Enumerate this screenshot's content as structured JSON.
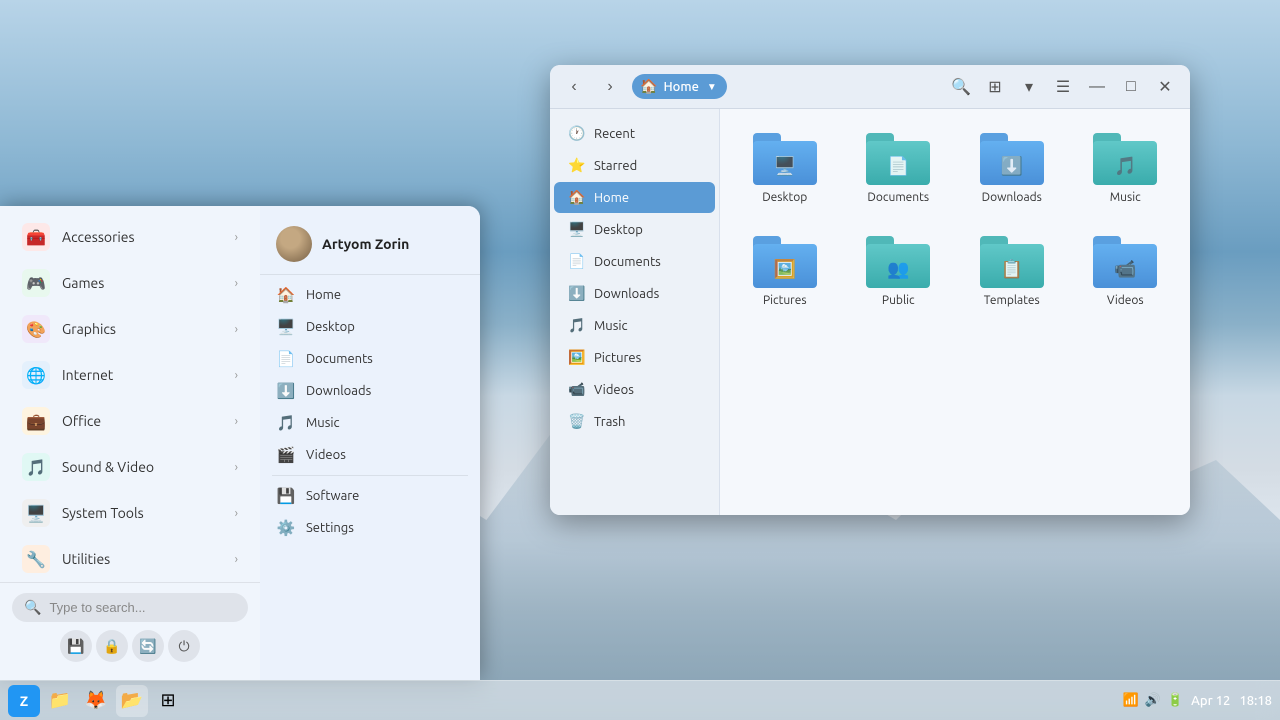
{
  "desktop": {
    "bg": "mountain"
  },
  "taskbar": {
    "time": "18:18",
    "date": "Apr 12",
    "icons": [
      {
        "name": "zorin-menu",
        "label": "Z",
        "active": false
      },
      {
        "name": "files",
        "label": "📁",
        "active": false
      },
      {
        "name": "firefox",
        "label": "🦊",
        "active": false
      },
      {
        "name": "file-manager",
        "label": "📂",
        "active": true
      },
      {
        "name": "zorin-connect",
        "label": "⊞",
        "active": false
      }
    ]
  },
  "app_menu": {
    "user": {
      "name": "Artyom Zorin",
      "avatar": "user"
    },
    "quick_items": [
      {
        "icon": "🏠",
        "label": "Home"
      },
      {
        "icon": "🖥️",
        "label": "Desktop"
      },
      {
        "icon": "📄",
        "label": "Documents"
      },
      {
        "icon": "⬇️",
        "label": "Downloads"
      },
      {
        "icon": "🎵",
        "label": "Music"
      },
      {
        "icon": "🎬",
        "label": "Videos"
      }
    ],
    "bottom_items": [
      {
        "icon": "💾",
        "label": "Software"
      },
      {
        "icon": "⚙️",
        "label": "Settings"
      }
    ],
    "categories": [
      {
        "icon": "🧰",
        "label": "Accessories",
        "color": "#e74c3c"
      },
      {
        "icon": "🎮",
        "label": "Games",
        "color": "#2ecc71"
      },
      {
        "icon": "🎨",
        "label": "Graphics",
        "color": "#9b59b6"
      },
      {
        "icon": "🌐",
        "label": "Internet",
        "color": "#3498db"
      },
      {
        "icon": "💼",
        "label": "Office",
        "color": "#f39c12"
      },
      {
        "icon": "🎵",
        "label": "Sound & Video",
        "color": "#1abc9c"
      },
      {
        "icon": "🖥️",
        "label": "System Tools",
        "color": "#7f8c8d"
      },
      {
        "icon": "🔧",
        "label": "Utilities",
        "color": "#e67e22"
      }
    ],
    "search_placeholder": "Type to search...",
    "action_buttons": [
      {
        "icon": "💾",
        "label": "save"
      },
      {
        "icon": "🔒",
        "label": "lock"
      },
      {
        "icon": "🔄",
        "label": "refresh"
      },
      {
        "icon": "⏻",
        "label": "power"
      }
    ]
  },
  "file_manager": {
    "title": "Home",
    "location": "Home",
    "sidebar_items": [
      {
        "icon": "🕐",
        "label": "Recent",
        "active": false
      },
      {
        "icon": "⭐",
        "label": "Starred",
        "active": false
      },
      {
        "icon": "🏠",
        "label": "Home",
        "active": true
      },
      {
        "icon": "🖥️",
        "label": "Desktop",
        "active": false
      },
      {
        "icon": "📄",
        "label": "Documents",
        "active": false
      },
      {
        "icon": "⬇️",
        "label": "Downloads",
        "active": false
      },
      {
        "icon": "🎵",
        "label": "Music",
        "active": false
      },
      {
        "icon": "🖼️",
        "label": "Pictures",
        "active": false
      },
      {
        "icon": "📹",
        "label": "Videos",
        "active": false
      },
      {
        "icon": "🗑️",
        "label": "Trash",
        "active": false
      }
    ],
    "folders": [
      {
        "label": "Desktop",
        "color": "blue",
        "icon": "🖥️"
      },
      {
        "label": "Documents",
        "color": "teal",
        "icon": "📄"
      },
      {
        "label": "Downloads",
        "color": "blue",
        "icon": "⬇️"
      },
      {
        "label": "Music",
        "color": "teal",
        "icon": "🎵"
      },
      {
        "label": "Pictures",
        "color": "blue",
        "icon": "🖼️"
      },
      {
        "label": "Public",
        "color": "teal",
        "icon": "👥"
      },
      {
        "label": "Templates",
        "color": "teal",
        "icon": "📋"
      },
      {
        "label": "Videos",
        "color": "blue",
        "icon": "📹"
      }
    ]
  }
}
